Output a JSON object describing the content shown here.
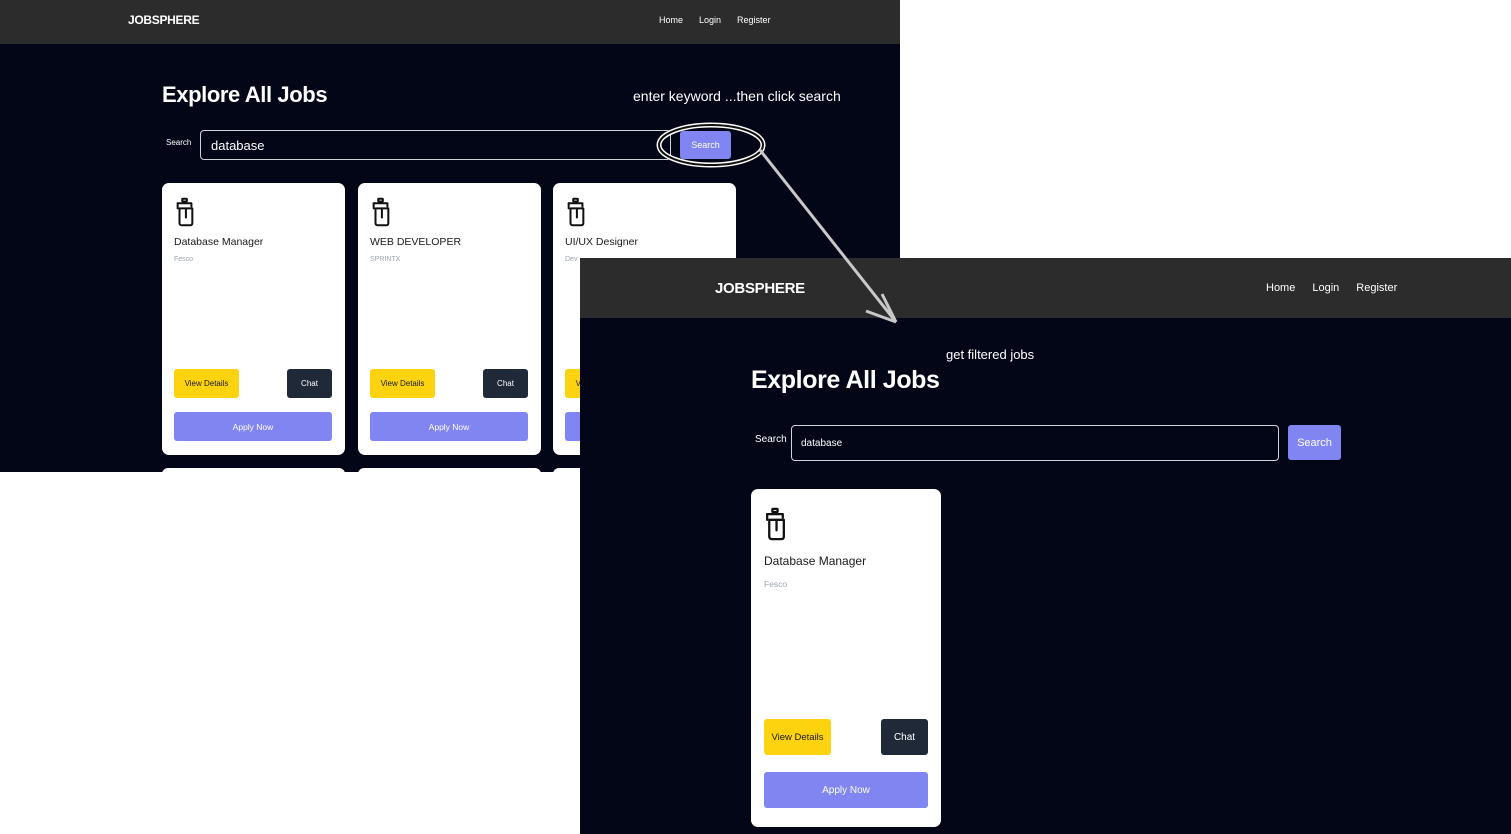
{
  "before": {
    "nav": {
      "brand": "JOBSPHERE",
      "links": [
        "Home",
        "Login",
        "Register"
      ]
    },
    "heading": "Explore All Jobs",
    "search": {
      "label": "Search",
      "value": "database",
      "button": "Search"
    },
    "jobs": [
      {
        "title": "Database Manager",
        "company": "Fesco"
      },
      {
        "title": "WEB DEVELOPER",
        "company": "SPRINTX"
      },
      {
        "title": "UI/UX Designer",
        "company": "Dev"
      }
    ],
    "buttons": {
      "details": "View Details",
      "chat": "Chat",
      "apply": "Apply Now"
    }
  },
  "after": {
    "nav": {
      "brand": "JOBSPHERE",
      "links": [
        "Home",
        "Login",
        "Register"
      ]
    },
    "heading": "Explore All Jobs",
    "search": {
      "label": "Search",
      "value": "database",
      "button": "Search"
    },
    "jobs": [
      {
        "title": "Database Manager",
        "company": "Fesco"
      }
    ],
    "buttons": {
      "details": "View Details",
      "chat": "Chat",
      "apply": "Apply Now"
    }
  },
  "annotations": {
    "step_1": "enter keyword ...then click search",
    "step_2": "get filtered jobs"
  },
  "colors": {
    "background": "#020617",
    "navbar": "#2c2c2c",
    "accent": "#8185f1",
    "details_button": "#fcd30e",
    "chat_button": "#1f2937"
  },
  "icons": {
    "job_card": "mixer-bottle-icon"
  }
}
